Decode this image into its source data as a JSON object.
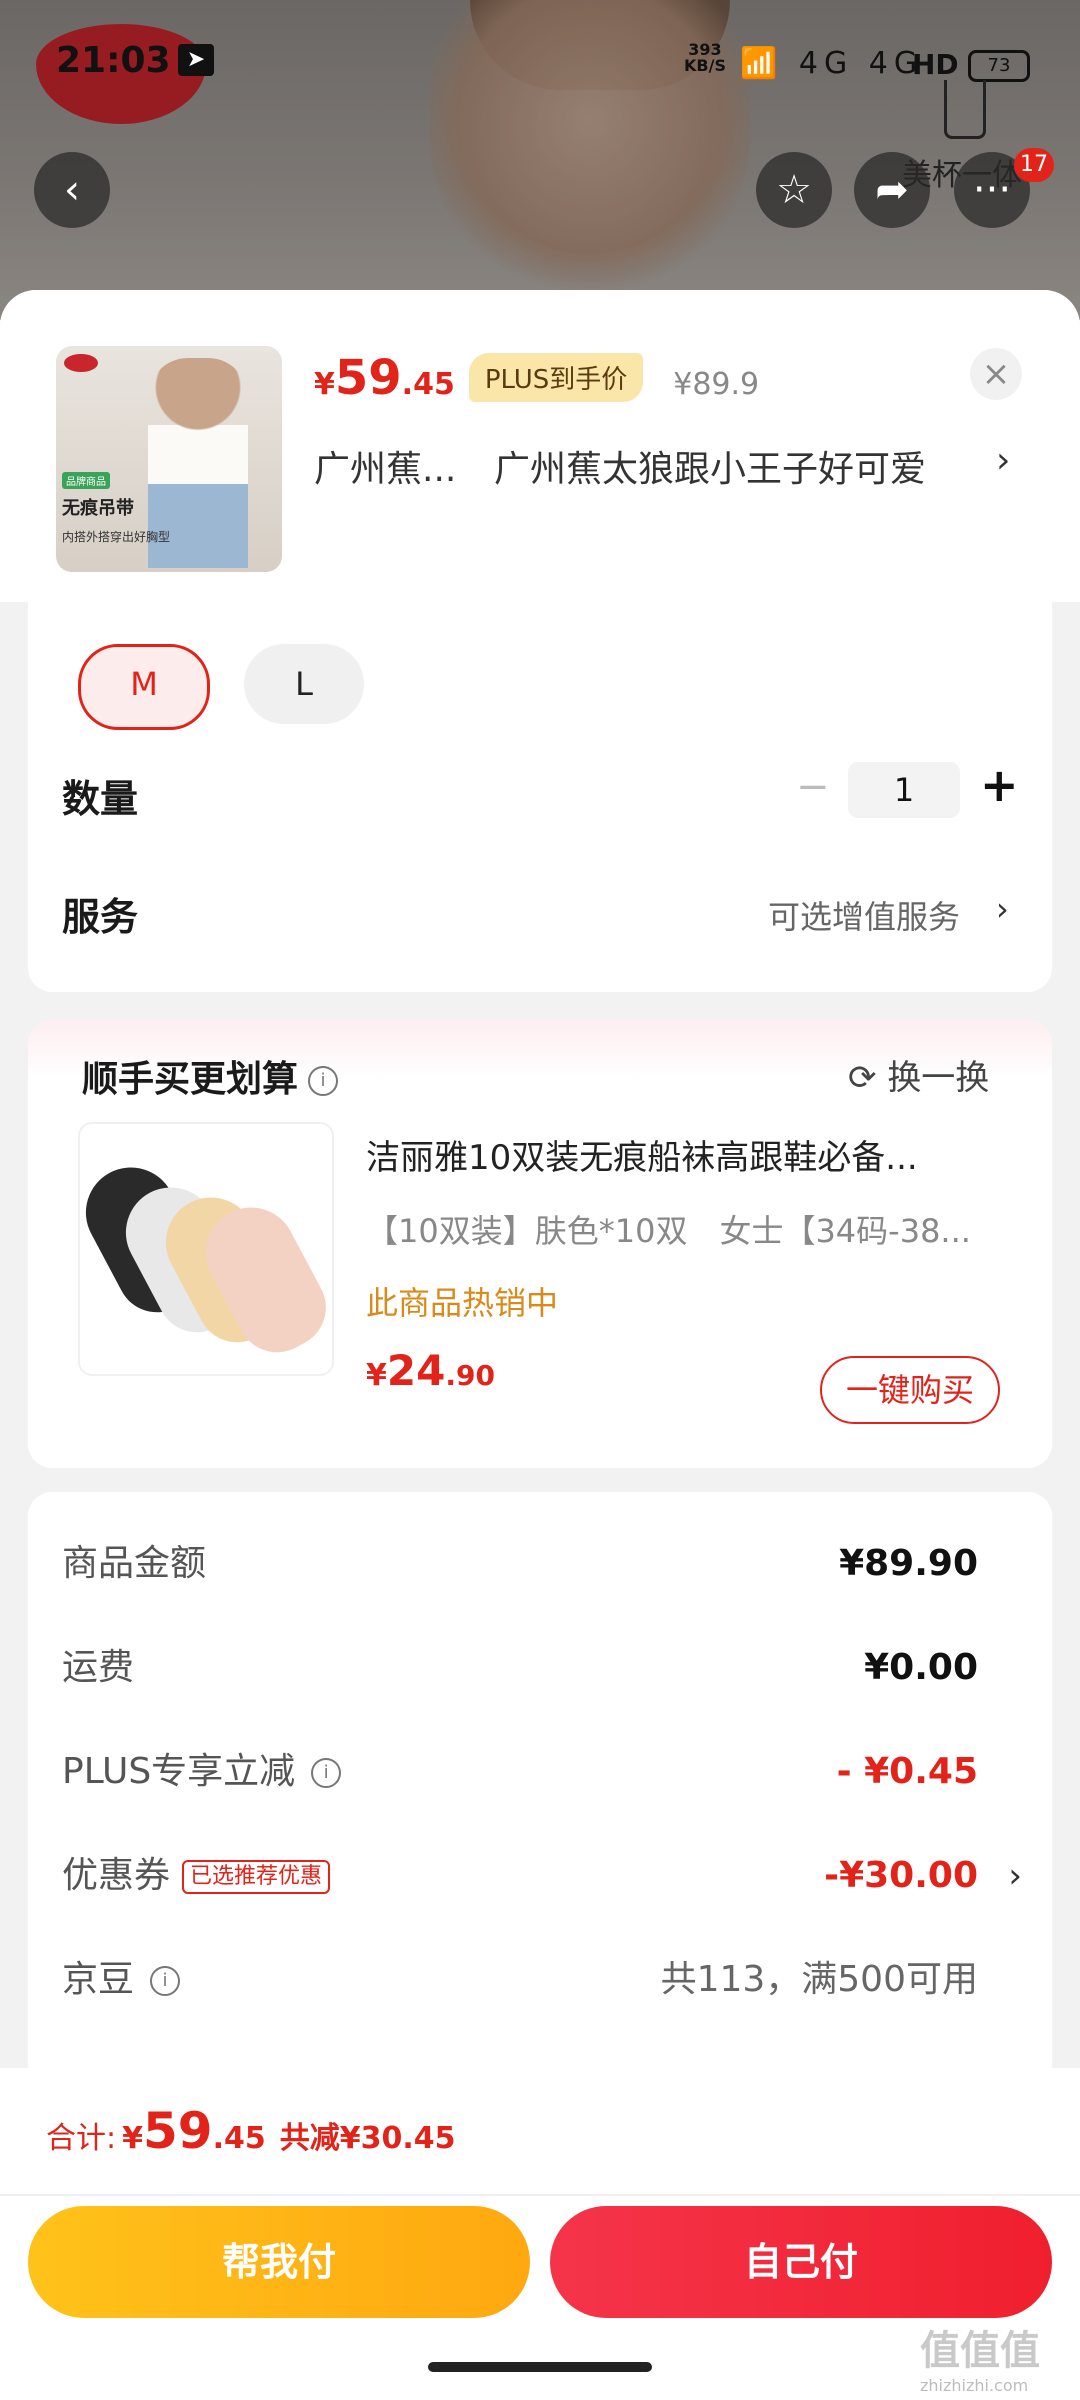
{
  "status_bar": {
    "time": "21:03",
    "net_speed": "393",
    "net_unit": "KB/S",
    "signal_icons": "📶 4G 4G",
    "hd": "HD",
    "battery": "73"
  },
  "top_nav": {
    "back_icon": "chevron-left-icon",
    "favorite_icon": "star-icon",
    "share_icon": "share-icon",
    "more_icon": "more-icon",
    "more_badge": "17",
    "tank_label": "美杯一体"
  },
  "product": {
    "price_currency": "¥",
    "price_int": "59",
    "price_dec": ".45",
    "plus_tag": "PLUS到手价",
    "original_price": "¥89.9",
    "close": "×",
    "address_short": "广州蕉...",
    "address_full": "广州蕉太狼跟小王子好可爱",
    "address_arrow": "›",
    "thumb_title": "无痕吊带",
    "thumb_sub": "内搭外搭穿出好胸型",
    "thumb_tag": "品牌商品"
  },
  "options": {
    "sizes": [
      {
        "label": "M",
        "selected": true
      },
      {
        "label": "L",
        "selected": false
      }
    ],
    "quantity_label": "数量",
    "quantity_minus": "−",
    "quantity_value": "1",
    "quantity_plus": "+",
    "service_label": "服务",
    "service_value": "可选增值服务",
    "service_arrow": "›"
  },
  "recommend": {
    "title": "顺手买更划算",
    "info": "i",
    "swap": "换一换",
    "item_name": "洁丽雅10双装无痕船袜高跟鞋必备...",
    "item_spec": "【10双装】肤色*10双　女士【34码-38...",
    "hot_text": "此商品热销中",
    "price_currency": "¥",
    "price_int": "24",
    "price_dec": ".90",
    "buy_label": "一键购买"
  },
  "fees": {
    "goods_label": "商品金额",
    "goods_value": "¥89.90",
    "shipping_label": "运费",
    "shipping_value": "¥0.00",
    "plus_label": "PLUS专享立减",
    "plus_value": "- ¥0.45",
    "coupon_label": "优惠券",
    "coupon_tag": "已选推荐优惠",
    "coupon_value": "-¥30.00",
    "coupon_arrow": "›",
    "jd_label": "京豆",
    "jd_value": "共113，满500可用"
  },
  "bottom": {
    "total_label": "合计:",
    "total_currency": "¥",
    "total_int": "59",
    "total_dec": ".45",
    "total_save": "共减¥30.45",
    "help_pay": "帮我付",
    "self_pay": "自己付"
  },
  "watermark": {
    "text": "值值值",
    "sub": "zhizhizhi.com"
  },
  "colors": {
    "accent_red": "#e2231a",
    "plus_gold": "#fbe6a9",
    "help_btn": "#ffb315",
    "self_btn": "#f2283b"
  }
}
